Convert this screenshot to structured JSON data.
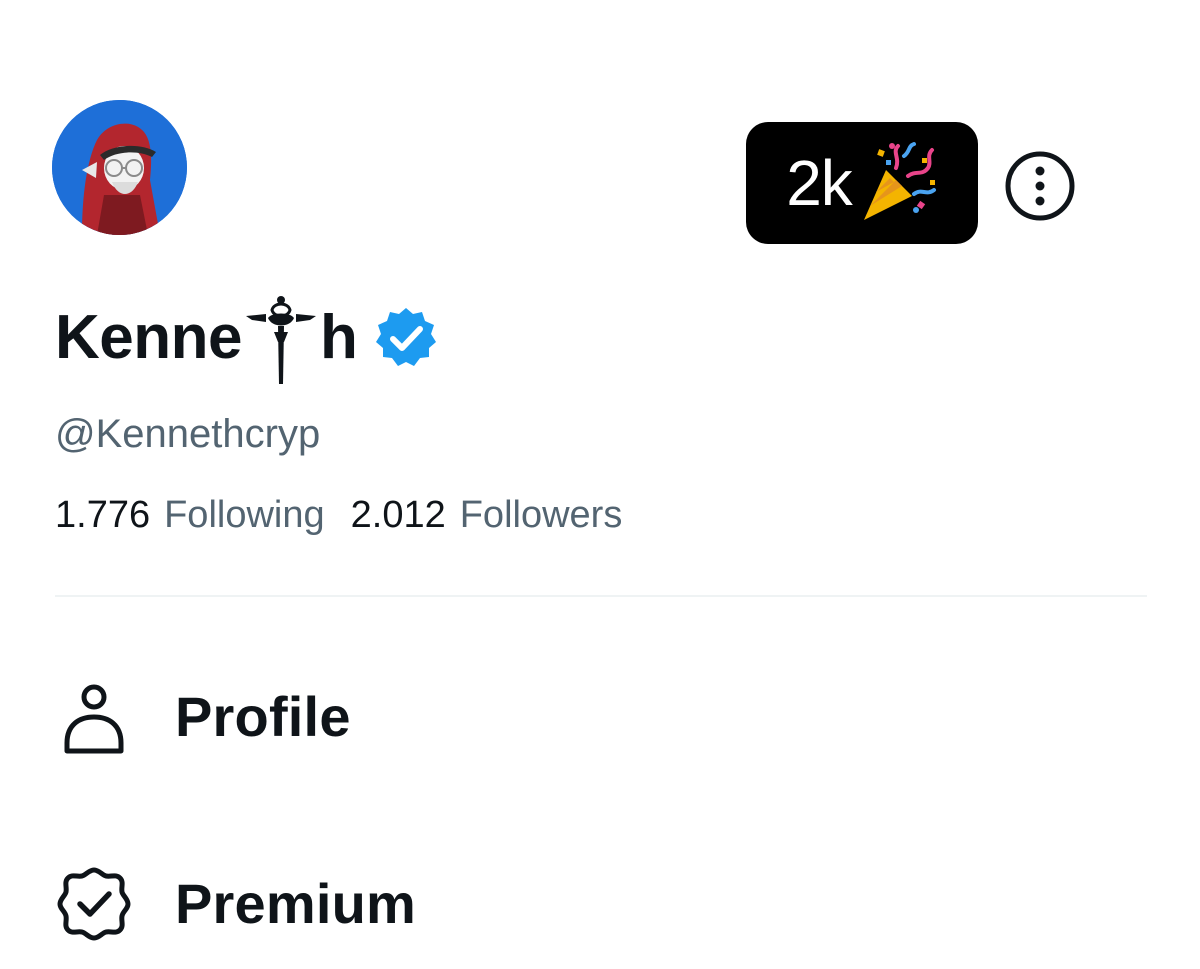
{
  "header": {
    "milestone_badge": {
      "text": "2k",
      "icon": "party-popper-icon",
      "background": "#000000"
    },
    "more_icon": "more-options-icon"
  },
  "profile": {
    "display_name_start": "Kenne",
    "display_name_end": "h",
    "verified_icon": "verified-badge-icon",
    "handle": "@Kennethcryp",
    "following_count": "1.776",
    "following_label": "Following",
    "followers_count": "2.012",
    "followers_label": "Followers"
  },
  "menu": {
    "items": [
      {
        "label": "Profile",
        "icon": "person-icon"
      },
      {
        "label": "Premium",
        "icon": "premium-verified-icon"
      }
    ]
  },
  "colors": {
    "text_primary": "#0f1419",
    "text_secondary": "#536471",
    "verified_blue": "#1d9bf0",
    "divider": "#eff3f4"
  }
}
